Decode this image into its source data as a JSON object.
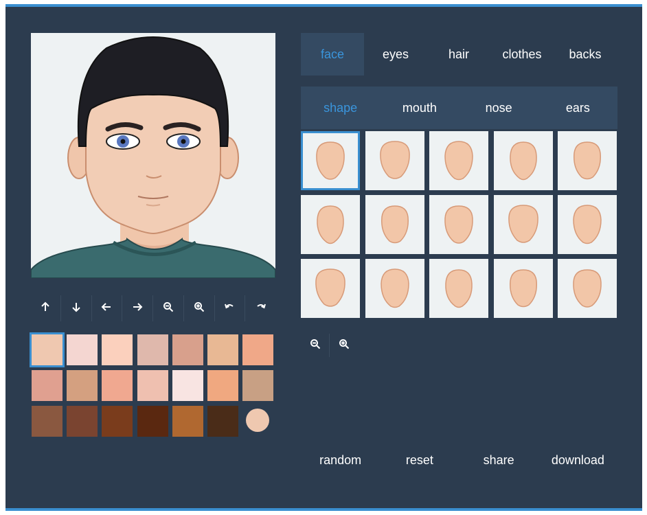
{
  "main_tabs": [
    {
      "label": "face",
      "active": true
    },
    {
      "label": "eyes",
      "active": false
    },
    {
      "label": "hair",
      "active": false
    },
    {
      "label": "clothes",
      "active": false
    },
    {
      "label": "backs",
      "active": false
    }
  ],
  "sub_tabs": [
    {
      "label": "shape",
      "active": true
    },
    {
      "label": "mouth",
      "active": false
    },
    {
      "label": "nose",
      "active": false
    },
    {
      "label": "ears",
      "active": false
    }
  ],
  "toolbar_icons": [
    "arrow-up-icon",
    "arrow-down-icon",
    "arrow-left-icon",
    "arrow-right-icon",
    "zoom-out-icon",
    "zoom-in-icon",
    "undo-icon",
    "redo-icon"
  ],
  "grid_zoom_icons": [
    "zoom-out-icon",
    "zoom-in-icon"
  ],
  "skin_colors": [
    [
      "#efc8b0",
      "#f4d6d1",
      "#fbd0bd",
      "#dfb8ac",
      "#d8a08c",
      "#e8b894",
      "#f0a888"
    ],
    [
      "#e0a090",
      "#d4a080",
      "#f0a890",
      "#efc0b0",
      "#f8e4e2",
      "#f0a880",
      "#c8a084"
    ],
    [
      "#8a5840",
      "#7a4430",
      "#7a3c1c",
      "#5a2810",
      "#b06830",
      "#4a2c18"
    ]
  ],
  "selected_swatch": [
    0,
    0
  ],
  "current_color": "#efc8b0",
  "face_shapes_selected": 0,
  "actions": [
    "random",
    "reset",
    "share",
    "download"
  ],
  "colors": {
    "background": "#2c3c4f",
    "accent": "#3a8fd0",
    "panel": "#344a62",
    "tile": "#eef2f3",
    "skin": "#f2cdb5",
    "shirt": "#3a6b6e",
    "hair": "#1e1e24"
  }
}
